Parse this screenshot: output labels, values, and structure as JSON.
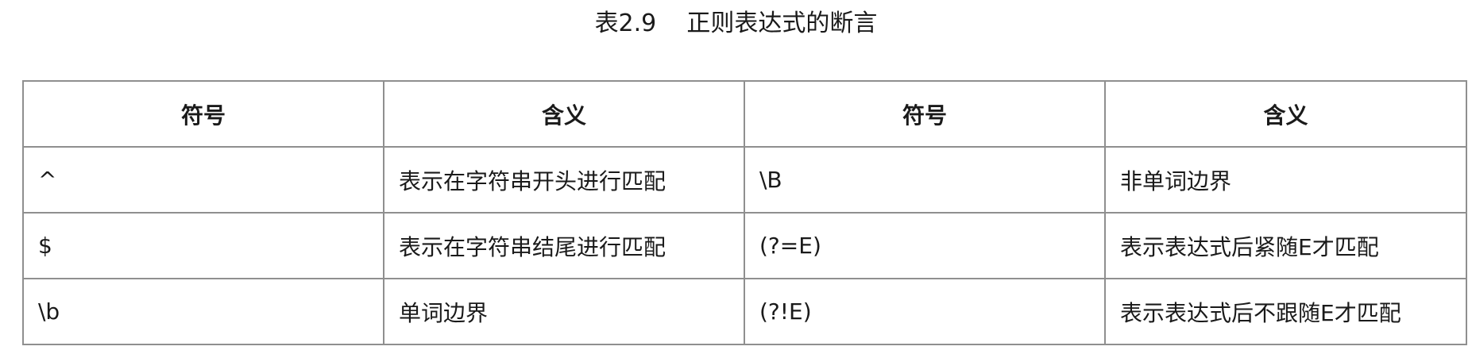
{
  "caption": "表2.9    正则表达式的断言",
  "table": {
    "headers": [
      "符号",
      "含义",
      "符号",
      "含义"
    ],
    "rows": [
      [
        "^",
        "表示在字符串开头进行匹配",
        "\\B",
        "非单词边界"
      ],
      [
        "$",
        "表示在字符串结尾进行匹配",
        "(?=E)",
        "表示表达式后紧随E才匹配"
      ],
      [
        "\\b",
        "单词边界",
        "(?!E)",
        "表示表达式后不跟随E才匹配"
      ]
    ]
  }
}
